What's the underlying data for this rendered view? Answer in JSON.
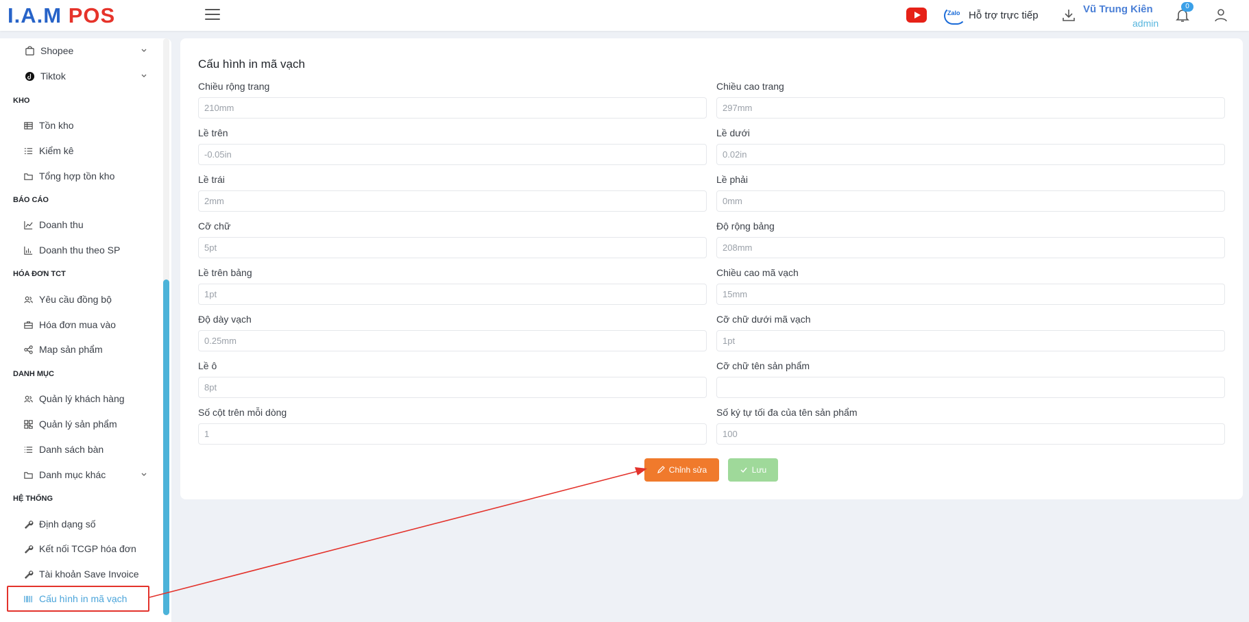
{
  "header": {
    "logo_part1": "I.A.M",
    "logo_part2": "POS",
    "zalo_label": "Zalo",
    "support_label": "Hỗ trợ trực tiếp",
    "user_name": "Vũ Trung Kiên",
    "user_role": "admin",
    "notification_count": "0"
  },
  "sidebar": {
    "items_top": [
      {
        "label": "Shopee",
        "icon": "shopee-icon"
      },
      {
        "label": "Tiktok",
        "icon": "tiktok-icon"
      }
    ],
    "sections": [
      {
        "title": "KHO",
        "items": [
          "Tồn kho",
          "Kiểm kê",
          "Tổng hợp tồn kho"
        ]
      },
      {
        "title": "BÁO CÁO",
        "items": [
          "Doanh thu",
          "Doanh thu theo SP"
        ]
      },
      {
        "title": "HÓA ĐƠN TCT",
        "items": [
          "Yêu cầu đồng bộ",
          "Hóa đơn mua vào",
          "Map sản phẩm"
        ]
      },
      {
        "title": "DANH MỤC",
        "items": [
          "Quản lý khách hàng",
          "Quản lý sản phẩm",
          "Danh sách bàn",
          "Danh mục khác"
        ]
      },
      {
        "title": "HỆ THỐNG",
        "items": [
          "Định dạng số",
          "Kết nối TCGP hóa đơn",
          "Tài khoản Save Invoice",
          "Cấu hình in mã vạch"
        ]
      }
    ]
  },
  "form": {
    "title": "Cấu hình in mã vạch",
    "fields": [
      {
        "label": "Chiều rộng trang",
        "value": "210mm"
      },
      {
        "label": "Chiều cao trang",
        "value": "297mm"
      },
      {
        "label": "Lề trên",
        "value": "-0.05in"
      },
      {
        "label": "Lề dưới",
        "value": "0.02in"
      },
      {
        "label": "Lề trái",
        "value": "2mm"
      },
      {
        "label": "Lề phải",
        "value": "0mm"
      },
      {
        "label": "Cỡ chữ",
        "value": "5pt"
      },
      {
        "label": "Độ rộng bảng",
        "value": "208mm"
      },
      {
        "label": "Lề trên bảng",
        "value": "1pt"
      },
      {
        "label": "Chiều cao mã vạch",
        "value": "15mm"
      },
      {
        "label": "Độ dày vạch",
        "value": "0.25mm"
      },
      {
        "label": "Cỡ chữ dưới mã vạch",
        "value": "1pt"
      },
      {
        "label": "Lề ô",
        "value": "8pt"
      },
      {
        "label": "Cỡ chữ tên sản phẩm",
        "value": ""
      },
      {
        "label": "Số cột trên mỗi dòng",
        "value": "1"
      },
      {
        "label": "Số ký tự tối đa của tên sản phẩm",
        "value": "100"
      }
    ],
    "edit_button": "Chỉnh sửa",
    "save_button": "Lưu"
  },
  "colors": {
    "accent": "#4aa4da",
    "edit": "#f07a2c",
    "save": "#9fd99a",
    "annotation": "#e3322b"
  }
}
